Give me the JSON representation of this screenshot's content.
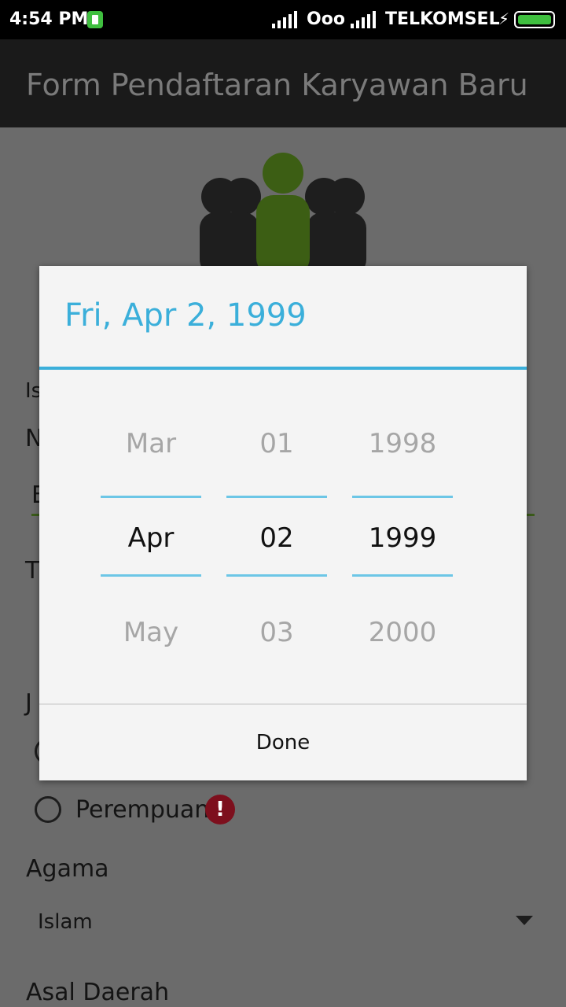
{
  "status_bar": {
    "time": "4:54 PM",
    "carrier_1": "Ooo",
    "carrier_2": "TELKOMSEL",
    "battery_color": "#3fbf3f"
  },
  "app_bar": {
    "title": "Form Pendaftaran Karyawan Baru"
  },
  "form": {
    "partial_label_1": "Is",
    "partial_label_2": "N",
    "partial_value_1": "B",
    "partial_label_3": "T",
    "partial_label_4": "J",
    "radio_female_label": "Perempuan",
    "error_icon": "!",
    "religion_label": "Agama",
    "religion_value": "Islam",
    "origin_label": "Asal Daerah"
  },
  "date_picker": {
    "header": "Fri, Apr 2, 1999",
    "month": {
      "prev": "Mar",
      "current": "Apr",
      "next": "May"
    },
    "day": {
      "prev": "01",
      "current": "02",
      "next": "03"
    },
    "year": {
      "prev": "1998",
      "current": "1999",
      "next": "2000"
    },
    "done_label": "Done",
    "accent_color": "#3bafda"
  }
}
